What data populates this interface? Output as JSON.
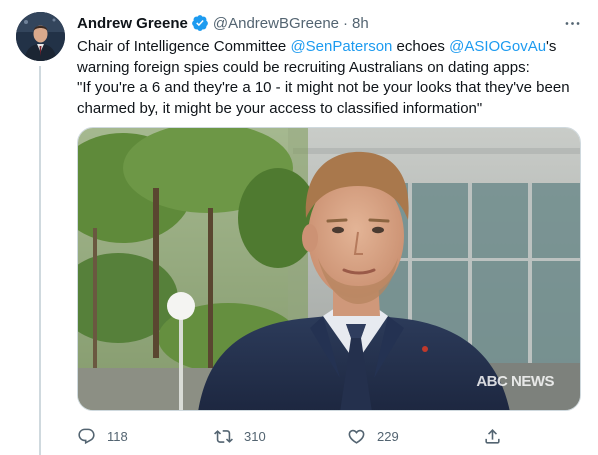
{
  "tweet": {
    "author": {
      "name": "Andrew Greene",
      "handle": "@AndrewBGreene",
      "verified": true
    },
    "separator": "·",
    "time": "8h",
    "text": {
      "line1_prefix": "Chair of Intelligence Committee ",
      "mention1": "@SenPaterson",
      "line1_middle": " echoes ",
      "mention2": "@ASIOGovAu",
      "line1_suffix": "'s",
      "line2": "warning foreign spies could be recruiting Australians on dating apps:",
      "line3": "\"If you're a 6 and they're a 10 - it might not be your looks that they've been",
      "line4": "charmed by, it might be your access to classified information\""
    },
    "media": {
      "watermark": "ABC NEWS"
    },
    "actions": {
      "reply_count": "118",
      "retweet_count": "310",
      "like_count": "229"
    }
  },
  "colors": {
    "link": "#1d9bf0",
    "secondary_text": "#536471",
    "primary_text": "#0f1419",
    "verified_badge": "#1d9bf0"
  },
  "icons": {
    "verified": "verified-badge-icon",
    "more": "more-options-icon",
    "reply": "reply-icon",
    "retweet": "retweet-icon",
    "like": "heart-icon",
    "share": "share-icon"
  }
}
